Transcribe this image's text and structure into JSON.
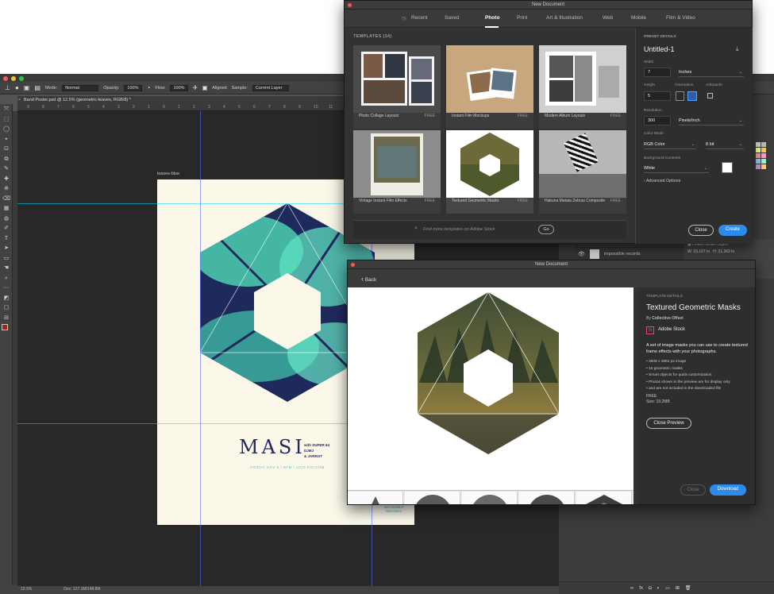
{
  "photoshop": {
    "options_bar": {
      "mode_label": "Mode:",
      "mode_value": "Normal",
      "opacity_label": "Opacity:",
      "opacity_value": "100%",
      "flow_label": "Flow:",
      "flow_value": "100%",
      "aligned_label": "Aligned",
      "sample_label": "Sample:",
      "sample_value": "Current Layer"
    },
    "document_tab": "Band Poster.psd @ 12.5% (geometric-leaves, RGB/8) *",
    "ruler_ticks": [
      "9",
      "8",
      "7",
      "6",
      "5",
      "4",
      "3",
      "2",
      "1",
      "0",
      "1",
      "2",
      "3",
      "4",
      "5",
      "6",
      "7",
      "8",
      "9",
      "10",
      "11",
      "12"
    ],
    "artboard_label": "leaves-blue",
    "poster": {
      "title": "MASI",
      "with_line": "with SUPER 64",
      "djmj": "DJMJ",
      "jarrot": "& JARROT",
      "date_line": "FRIDAY NOV 5 / 9PM / 1015 FOLSOM",
      "badge_line1": "IMPOSSIBLE",
      "badge_line2": "RECORDS"
    },
    "status": {
      "zoom": "12.5%",
      "doc": "Doc: 127.1M/148.8M"
    },
    "layers": {
      "layer_name": "impossible records",
      "props_title": "Linked Smart Object",
      "props_w": "W: 15.107 in",
      "props_h": "H: 21.363 in"
    },
    "bottom_icons": [
      "link-icon",
      "fx-icon",
      "mask-icon",
      "adjustment-icon",
      "folder-icon",
      "new-layer-icon",
      "trash-icon"
    ],
    "bottom_glyphs": [
      "∞",
      "fx",
      "◘",
      "◐",
      "▭",
      "⊞",
      "🗑"
    ],
    "swatch_colors": [
      "#d9d9d9",
      "#bfbfbf",
      "#ffff99",
      "#ffcc66",
      "#ff9999",
      "#ff99cc",
      "#99ccff",
      "#99ffcc",
      "#c9a0dc",
      "#ffd27f"
    ],
    "tools": [
      "⤧",
      "⬚",
      "◯",
      "⌖",
      "⊡",
      "⧉",
      "✎",
      "✚",
      "⊕",
      "⌫",
      "▦",
      "◍",
      "✐",
      "T",
      "➤",
      "▭",
      "☚",
      "⌕",
      "⋯",
      "◩",
      "▢",
      "⊟"
    ]
  },
  "dialog_presets": {
    "title": "New Document",
    "tabs": [
      {
        "label": "Recent"
      },
      {
        "label": "Saved"
      },
      {
        "label": "Photo"
      },
      {
        "label": "Print"
      },
      {
        "label": "Art & Illustration"
      },
      {
        "label": "Web"
      },
      {
        "label": "Mobile"
      },
      {
        "label": "Film & Video"
      }
    ],
    "templates_heading": "TEMPLATES",
    "templates_count": "(14)",
    "templates": [
      {
        "name": "Photo Collage Layouts",
        "badge": "FREE"
      },
      {
        "name": "Instant Film Mockups",
        "badge": "FREE"
      },
      {
        "name": "Modern Album Layouts",
        "badge": "FREE"
      },
      {
        "name": "Vintage Instant Film Effects",
        "badge": "FREE"
      },
      {
        "name": "Textured Geometric Masks",
        "badge": "FREE"
      },
      {
        "name": "Hakuna Matata Zebras Composite",
        "badge": "FREE"
      }
    ],
    "stock_search_placeholder": "Find more templates on Adobe Stock",
    "go_label": "Go",
    "preset": {
      "heading": "PRESET DETAILS",
      "name": "Untitled-1",
      "width_label": "Width",
      "width_value": "7",
      "units": "Inches",
      "height_label": "Height",
      "height_value": "5",
      "orientation_label": "Orientation",
      "artboards_label": "Artboards",
      "resolution_label": "Resolution",
      "resolution_value": "300",
      "resolution_units": "Pixels/Inch",
      "color_mode_label": "Color Mode",
      "color_mode_value": "RGB Color",
      "bit_depth": "8 bit",
      "background_label": "Background Contents",
      "background_value": "White",
      "advanced": "› Advanced Options",
      "close_label": "Close",
      "create_label": "Create"
    }
  },
  "dialog_details": {
    "title": "New Document",
    "back_label": "Back",
    "section_label": "TEMPLATE DETAILS",
    "template_name": "Textured Geometric Masks",
    "by_prefix": "By",
    "author": "Collective Offset",
    "stock_label": "Adobe Stock",
    "stock_badge": "St",
    "description": "A set of image masks you can use to create textured frame effects with your photographs.",
    "bullets": [
      "3508 x 4961 px image",
      "15 geometric masks",
      "Smart objects for quick customization",
      "Photos shown in the preview are for display only",
      "and are not included in the downloaded file"
    ],
    "price": "FREE",
    "size": "Size: 19.2MB",
    "close_preview_label": "Close Preview",
    "close_label": "Close",
    "download_label": "Download"
  },
  "colors": {
    "accent_blue": "#2d8ceb",
    "poster_navy": "#23285f",
    "poster_teal": "#5ac7c0"
  }
}
